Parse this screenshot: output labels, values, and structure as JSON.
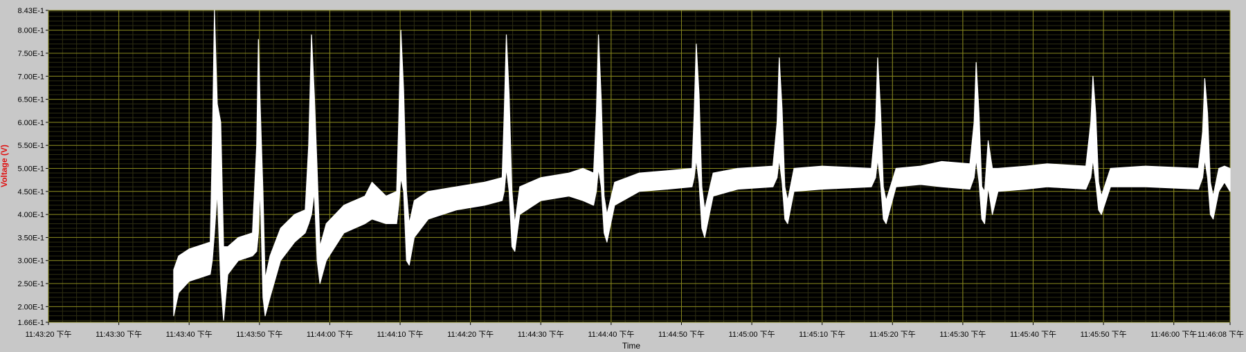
{
  "colors": {
    "frame": "#c8c8c8",
    "plot_bg": "#000000",
    "major_grid": "#8a8a1e",
    "minor_grid": "#2e2e12",
    "trace": "#ffffff",
    "ylabel": "#e01010",
    "tick_text": "#000000"
  },
  "chart_data": {
    "type": "line",
    "title": "",
    "xlabel": "Time",
    "ylabel": "Voltage (V)",
    "xlim_seconds": [
      0,
      168
    ],
    "ylim": [
      0.166,
      0.843
    ],
    "grid": true,
    "x_ticks": [
      {
        "t": 0,
        "label": "11:43:20 下午"
      },
      {
        "t": 10,
        "label": "11:43:30 下午"
      },
      {
        "t": 20,
        "label": "11:43:40 下午"
      },
      {
        "t": 30,
        "label": "11:43:50 下午"
      },
      {
        "t": 40,
        "label": "11:44:00 下午"
      },
      {
        "t": 50,
        "label": "11:44:10 下午"
      },
      {
        "t": 60,
        "label": "11:44:20 下午"
      },
      {
        "t": 70,
        "label": "11:44:30 下午"
      },
      {
        "t": 80,
        "label": "11:44:40 下午"
      },
      {
        "t": 90,
        "label": "11:44:50 下午"
      },
      {
        "t": 100,
        "label": "11:45:00 下午"
      },
      {
        "t": 110,
        "label": "11:45:10 下午"
      },
      {
        "t": 120,
        "label": "11:45:20 下午"
      },
      {
        "t": 130,
        "label": "11:45:30 下午"
      },
      {
        "t": 140,
        "label": "11:45:40 下午"
      },
      {
        "t": 150,
        "label": "11:45:50 下午"
      },
      {
        "t": 160,
        "label": "11:46:00 下午"
      },
      {
        "t": 168,
        "label": "11:46:08 下午"
      }
    ],
    "y_ticks": [
      {
        "v": 0.166,
        "label": "1.66E-1"
      },
      {
        "v": 0.2,
        "label": "2.00E-1"
      },
      {
        "v": 0.25,
        "label": "2.50E-1"
      },
      {
        "v": 0.3,
        "label": "3.00E-1"
      },
      {
        "v": 0.35,
        "label": "3.50E-1"
      },
      {
        "v": 0.4,
        "label": "4.00E-1"
      },
      {
        "v": 0.45,
        "label": "4.50E-1"
      },
      {
        "v": 0.5,
        "label": "5.00E-1"
      },
      {
        "v": 0.55,
        "label": "5.50E-1"
      },
      {
        "v": 0.6,
        "label": "6.00E-1"
      },
      {
        "v": 0.65,
        "label": "6.50E-1"
      },
      {
        "v": 0.7,
        "label": "7.00E-1"
      },
      {
        "v": 0.75,
        "label": "7.50E-1"
      },
      {
        "v": 0.8,
        "label": "8.00E-1"
      },
      {
        "v": 0.843,
        "label": "8.43E-1"
      }
    ],
    "series": [
      {
        "envelope": [
          {
            "t": 17.8,
            "lo": 0.18,
            "hi": 0.28
          },
          {
            "t": 18.5,
            "lo": 0.23,
            "hi": 0.31
          },
          {
            "t": 20.0,
            "lo": 0.255,
            "hi": 0.325
          },
          {
            "t": 22.0,
            "lo": 0.265,
            "hi": 0.335
          },
          {
            "t": 23.0,
            "lo": 0.27,
            "hi": 0.34
          },
          {
            "t": 23.3,
            "lo": 0.3,
            "hi": 0.55
          },
          {
            "t": 23.6,
            "lo": 0.36,
            "hi": 0.843
          },
          {
            "t": 24.0,
            "lo": 0.45,
            "hi": 0.64
          },
          {
            "t": 24.5,
            "lo": 0.25,
            "hi": 0.6
          },
          {
            "t": 24.9,
            "lo": 0.17,
            "hi": 0.33
          },
          {
            "t": 25.5,
            "lo": 0.27,
            "hi": 0.33
          },
          {
            "t": 27.0,
            "lo": 0.3,
            "hi": 0.35
          },
          {
            "t": 29.0,
            "lo": 0.31,
            "hi": 0.36
          },
          {
            "t": 29.6,
            "lo": 0.32,
            "hi": 0.55
          },
          {
            "t": 29.85,
            "lo": 0.36,
            "hi": 0.78
          },
          {
            "t": 30.1,
            "lo": 0.46,
            "hi": 0.64
          },
          {
            "t": 30.5,
            "lo": 0.22,
            "hi": 0.45
          },
          {
            "t": 30.8,
            "lo": 0.18,
            "hi": 0.26
          },
          {
            "t": 31.5,
            "lo": 0.22,
            "hi": 0.31
          },
          {
            "t": 33.0,
            "lo": 0.3,
            "hi": 0.37
          },
          {
            "t": 35.0,
            "lo": 0.34,
            "hi": 0.4
          },
          {
            "t": 36.5,
            "lo": 0.36,
            "hi": 0.41
          },
          {
            "t": 37.0,
            "lo": 0.38,
            "hi": 0.55
          },
          {
            "t": 37.4,
            "lo": 0.4,
            "hi": 0.79
          },
          {
            "t": 37.8,
            "lo": 0.45,
            "hi": 0.66
          },
          {
            "t": 38.2,
            "lo": 0.3,
            "hi": 0.5
          },
          {
            "t": 38.6,
            "lo": 0.25,
            "hi": 0.33
          },
          {
            "t": 39.5,
            "lo": 0.3,
            "hi": 0.38
          },
          {
            "t": 42.0,
            "lo": 0.36,
            "hi": 0.42
          },
          {
            "t": 45.0,
            "lo": 0.38,
            "hi": 0.44
          },
          {
            "t": 46.0,
            "lo": 0.39,
            "hi": 0.47
          },
          {
            "t": 48.0,
            "lo": 0.38,
            "hi": 0.44
          },
          {
            "t": 49.5,
            "lo": 0.38,
            "hi": 0.45
          },
          {
            "t": 49.8,
            "lo": 0.42,
            "hi": 0.6
          },
          {
            "t": 50.1,
            "lo": 0.48,
            "hi": 0.8
          },
          {
            "t": 50.5,
            "lo": 0.45,
            "hi": 0.67
          },
          {
            "t": 50.9,
            "lo": 0.3,
            "hi": 0.45
          },
          {
            "t": 51.3,
            "lo": 0.29,
            "hi": 0.38
          },
          {
            "t": 52.0,
            "lo": 0.35,
            "hi": 0.43
          },
          {
            "t": 54.0,
            "lo": 0.39,
            "hi": 0.45
          },
          {
            "t": 58.0,
            "lo": 0.41,
            "hi": 0.46
          },
          {
            "t": 62.0,
            "lo": 0.42,
            "hi": 0.47
          },
          {
            "t": 64.5,
            "lo": 0.43,
            "hi": 0.48
          },
          {
            "t": 64.8,
            "lo": 0.45,
            "hi": 0.62
          },
          {
            "t": 65.1,
            "lo": 0.5,
            "hi": 0.79
          },
          {
            "t": 65.5,
            "lo": 0.45,
            "hi": 0.66
          },
          {
            "t": 65.9,
            "lo": 0.33,
            "hi": 0.45
          },
          {
            "t": 66.3,
            "lo": 0.32,
            "hi": 0.38
          },
          {
            "t": 67.0,
            "lo": 0.4,
            "hi": 0.46
          },
          {
            "t": 70.0,
            "lo": 0.43,
            "hi": 0.48
          },
          {
            "t": 74.0,
            "lo": 0.44,
            "hi": 0.49
          },
          {
            "t": 76.0,
            "lo": 0.43,
            "hi": 0.5
          },
          {
            "t": 77.5,
            "lo": 0.42,
            "hi": 0.49
          },
          {
            "t": 77.9,
            "lo": 0.45,
            "hi": 0.62
          },
          {
            "t": 78.2,
            "lo": 0.5,
            "hi": 0.79
          },
          {
            "t": 78.6,
            "lo": 0.46,
            "hi": 0.65
          },
          {
            "t": 79.0,
            "lo": 0.36,
            "hi": 0.44
          },
          {
            "t": 79.4,
            "lo": 0.34,
            "hi": 0.4
          },
          {
            "t": 80.5,
            "lo": 0.42,
            "hi": 0.47
          },
          {
            "t": 84.0,
            "lo": 0.45,
            "hi": 0.49
          },
          {
            "t": 88.0,
            "lo": 0.455,
            "hi": 0.495
          },
          {
            "t": 91.5,
            "lo": 0.46,
            "hi": 0.5
          },
          {
            "t": 91.8,
            "lo": 0.48,
            "hi": 0.62
          },
          {
            "t": 92.1,
            "lo": 0.52,
            "hi": 0.77
          },
          {
            "t": 92.5,
            "lo": 0.47,
            "hi": 0.66
          },
          {
            "t": 92.9,
            "lo": 0.37,
            "hi": 0.46
          },
          {
            "t": 93.3,
            "lo": 0.35,
            "hi": 0.41
          },
          {
            "t": 94.5,
            "lo": 0.44,
            "hi": 0.49
          },
          {
            "t": 98.0,
            "lo": 0.455,
            "hi": 0.5
          },
          {
            "t": 103.0,
            "lo": 0.46,
            "hi": 0.505
          },
          {
            "t": 103.6,
            "lo": 0.48,
            "hi": 0.6
          },
          {
            "t": 103.9,
            "lo": 0.52,
            "hi": 0.74
          },
          {
            "t": 104.3,
            "lo": 0.47,
            "hi": 0.63
          },
          {
            "t": 104.7,
            "lo": 0.39,
            "hi": 0.46
          },
          {
            "t": 105.1,
            "lo": 0.38,
            "hi": 0.43
          },
          {
            "t": 106.0,
            "lo": 0.45,
            "hi": 0.5
          },
          {
            "t": 110.0,
            "lo": 0.455,
            "hi": 0.505
          },
          {
            "t": 117.0,
            "lo": 0.46,
            "hi": 0.5
          },
          {
            "t": 117.6,
            "lo": 0.48,
            "hi": 0.6
          },
          {
            "t": 117.9,
            "lo": 0.52,
            "hi": 0.74
          },
          {
            "t": 118.3,
            "lo": 0.47,
            "hi": 0.63
          },
          {
            "t": 118.7,
            "lo": 0.39,
            "hi": 0.46
          },
          {
            "t": 119.1,
            "lo": 0.38,
            "hi": 0.43
          },
          {
            "t": 120.5,
            "lo": 0.46,
            "hi": 0.5
          },
          {
            "t": 124.0,
            "lo": 0.465,
            "hi": 0.505
          },
          {
            "t": 127.0,
            "lo": 0.46,
            "hi": 0.515
          },
          {
            "t": 131.0,
            "lo": 0.455,
            "hi": 0.51
          },
          {
            "t": 131.6,
            "lo": 0.48,
            "hi": 0.6
          },
          {
            "t": 131.9,
            "lo": 0.52,
            "hi": 0.73
          },
          {
            "t": 132.3,
            "lo": 0.47,
            "hi": 0.62
          },
          {
            "t": 132.7,
            "lo": 0.39,
            "hi": 0.46
          },
          {
            "t": 133.1,
            "lo": 0.38,
            "hi": 0.45
          },
          {
            "t": 133.6,
            "lo": 0.46,
            "hi": 0.56
          },
          {
            "t": 134.2,
            "lo": 0.4,
            "hi": 0.5
          },
          {
            "t": 135.0,
            "lo": 0.45,
            "hi": 0.5
          },
          {
            "t": 139.0,
            "lo": 0.455,
            "hi": 0.505
          },
          {
            "t": 142.0,
            "lo": 0.46,
            "hi": 0.51
          },
          {
            "t": 147.5,
            "lo": 0.455,
            "hi": 0.505
          },
          {
            "t": 148.2,
            "lo": 0.48,
            "hi": 0.6
          },
          {
            "t": 148.5,
            "lo": 0.52,
            "hi": 0.7
          },
          {
            "t": 148.9,
            "lo": 0.47,
            "hi": 0.62
          },
          {
            "t": 149.3,
            "lo": 0.41,
            "hi": 0.47
          },
          {
            "t": 149.7,
            "lo": 0.4,
            "hi": 0.44
          },
          {
            "t": 151.0,
            "lo": 0.46,
            "hi": 0.5
          },
          {
            "t": 156.0,
            "lo": 0.46,
            "hi": 0.505
          },
          {
            "t": 163.5,
            "lo": 0.455,
            "hi": 0.5
          },
          {
            "t": 164.1,
            "lo": 0.48,
            "hi": 0.58
          },
          {
            "t": 164.4,
            "lo": 0.52,
            "hi": 0.695
          },
          {
            "t": 164.8,
            "lo": 0.48,
            "hi": 0.62
          },
          {
            "t": 165.2,
            "lo": 0.4,
            "hi": 0.47
          },
          {
            "t": 165.6,
            "lo": 0.39,
            "hi": 0.44
          },
          {
            "t": 166.4,
            "lo": 0.45,
            "hi": 0.5
          },
          {
            "t": 167.2,
            "lo": 0.47,
            "hi": 0.505
          },
          {
            "t": 168.0,
            "lo": 0.45,
            "hi": 0.5
          }
        ]
      }
    ]
  }
}
